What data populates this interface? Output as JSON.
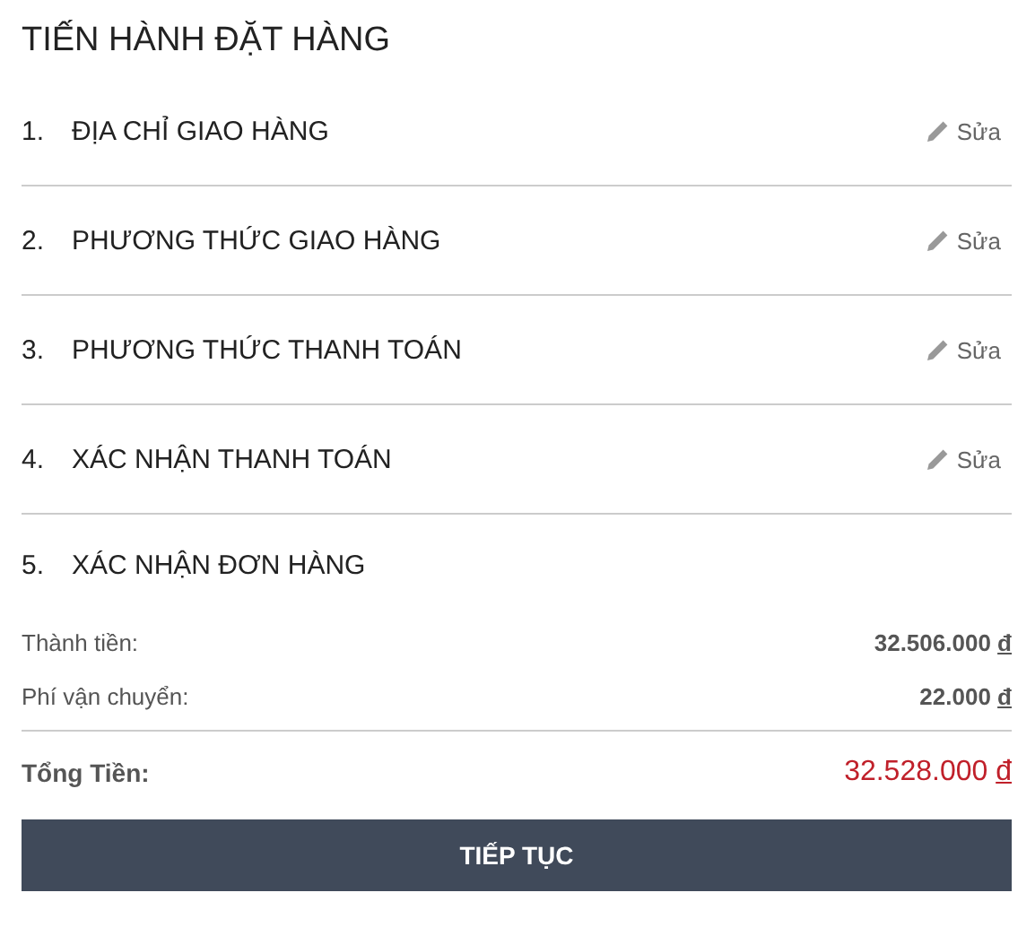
{
  "title": "TIẾN HÀNH ĐẶT HÀNG",
  "steps": [
    {
      "number": "1.",
      "label": "ĐỊA CHỈ GIAO HÀNG",
      "edit": "Sửa"
    },
    {
      "number": "2.",
      "label": "PHƯƠNG THỨC GIAO HÀNG",
      "edit": "Sửa"
    },
    {
      "number": "3.",
      "label": "PHƯƠNG THỨC THANH TOÁN",
      "edit": "Sửa"
    },
    {
      "number": "4.",
      "label": "XÁC NHẬN THANH TOÁN",
      "edit": "Sửa"
    },
    {
      "number": "5.",
      "label": "XÁC NHẬN ĐƠN HÀNG"
    }
  ],
  "summary": [
    {
      "kind": "line",
      "label": "Thành tiền:",
      "amount": "32.506.000",
      "currency": "đ"
    },
    {
      "kind": "line",
      "label": "Phí vận chuyển:",
      "amount": "22.000",
      "currency": "đ"
    },
    {
      "kind": "total",
      "label": "Tổng Tiền:",
      "amount": "32.528.000",
      "currency": "đ"
    }
  ],
  "button": "TIẾP TỤC"
}
